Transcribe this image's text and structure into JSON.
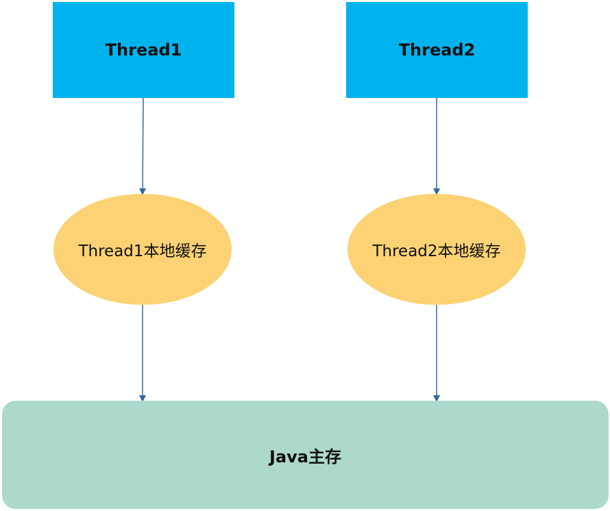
{
  "colors": {
    "thread": "#00b3ee",
    "cache": "#fcd274",
    "memory": "#acd9cc",
    "arrow": "#2e6a9e"
  },
  "nodes": {
    "thread1": {
      "label": "Thread1"
    },
    "thread2": {
      "label": "Thread2"
    },
    "cache1": {
      "label": "Thread1本地缓存"
    },
    "cache2": {
      "label": "Thread2本地缓存"
    },
    "main_memory": {
      "label": "Java主存"
    }
  },
  "edges": [
    {
      "from": "thread1",
      "to": "cache1"
    },
    {
      "from": "thread2",
      "to": "cache2"
    },
    {
      "from": "cache1",
      "to": "main_memory"
    },
    {
      "from": "cache2",
      "to": "main_memory"
    }
  ]
}
